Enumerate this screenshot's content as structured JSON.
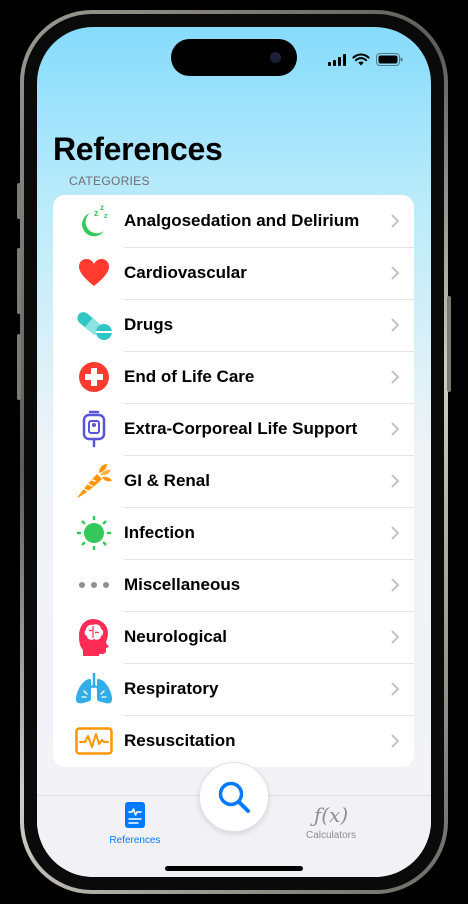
{
  "page": {
    "title": "References",
    "section_label": "CATEGORIES"
  },
  "categories": [
    {
      "label": "Analgosedation and Delirium",
      "icon": "moon-sleep-icon",
      "color": "#34c759"
    },
    {
      "label": "Cardiovascular",
      "icon": "heart-icon",
      "color": "#ff3b30"
    },
    {
      "label": "Drugs",
      "icon": "pills-icon",
      "color": "#30c6c4"
    },
    {
      "label": "End of Life Care",
      "icon": "medical-cross-icon",
      "color": "#ff3b30"
    },
    {
      "label": "Extra-Corporeal Life Support",
      "icon": "iv-bag-icon",
      "color": "#5856d6"
    },
    {
      "label": "GI & Renal",
      "icon": "carrot-icon",
      "color": "#ff9500"
    },
    {
      "label": "Infection",
      "icon": "microbe-icon",
      "color": "#34c759"
    },
    {
      "label": "Miscellaneous",
      "icon": "ellipsis-icon",
      "color": "#8e8e93"
    },
    {
      "label": "Neurological",
      "icon": "brain-head-icon",
      "color": "#ff2d55"
    },
    {
      "label": "Respiratory",
      "icon": "lungs-icon",
      "color": "#32ade6"
    },
    {
      "label": "Resuscitation",
      "icon": "ecg-monitor-icon",
      "color": "#ff9500"
    }
  ],
  "tabbar": {
    "references_label": "References",
    "calculators_label": "Calculators",
    "calculators_glyph": "ƒ(x)",
    "active_color": "#007aff",
    "inactive_color": "#8e8e93"
  }
}
